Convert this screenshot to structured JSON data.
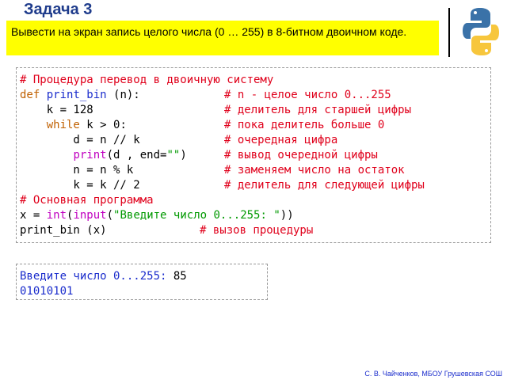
{
  "slide": {
    "title": "Задача 3",
    "task_text": "Вывести на экран запись целого числа (0 … 255) в 8-битном двоичном коде.",
    "credit": "С. В. Чайченков, МБОУ Грушевская СОШ"
  },
  "code": {
    "l1": "# Процедура перевод в двоичную систему",
    "l2_def": "def",
    "l2_fn": "print_bin",
    "l2_rest": " (n):",
    "l2_cmt": "# n - целое число 0...255",
    "l3_code": "    k = 128",
    "l3_cmt": "# делитель для старшей цифры",
    "l4_indent": "    ",
    "l4_kw": "while",
    "l4_rest": " k > 0:",
    "l4_cmt": "# пока делитель больше 0",
    "l5_code": "        d = n // k",
    "l5_cmt": "# очередная цифра",
    "l6_indent": "        ",
    "l6_fn": "print",
    "l6_a": "(d , end=",
    "l6_str": "\"\"",
    "l6_b": ")",
    "l6_cmt": "# вывод очередной цифры",
    "l7_code": "        n = n % k",
    "l7_cmt": "# заменяем число на остаток",
    "l8_code": "        k = k // 2",
    "l8_cmt": "# делитель для следующей цифры",
    "l9": "# Основная программа",
    "l10_a": "x = ",
    "l10_int": "int",
    "l10_p1": "(",
    "l10_input": "input",
    "l10_p2": "(",
    "l10_str": "\"Введите число 0...255: \"",
    "l10_p3": "))",
    "l11_code": "print_bin (x)",
    "l11_cmt": "# вызов процедуры"
  },
  "output": {
    "prompt": "Введите число 0...255: ",
    "entered": "85",
    "result": "01010101"
  },
  "colors": {
    "title": "#1f3c8c",
    "task_background": "#ffff00",
    "comment": "#e0001b",
    "keyword": "#c06000",
    "function_name": "#1a2ccc",
    "builtin": "#c000c0",
    "string": "#009900"
  },
  "icons": {
    "logo": "python-logo-icon"
  }
}
